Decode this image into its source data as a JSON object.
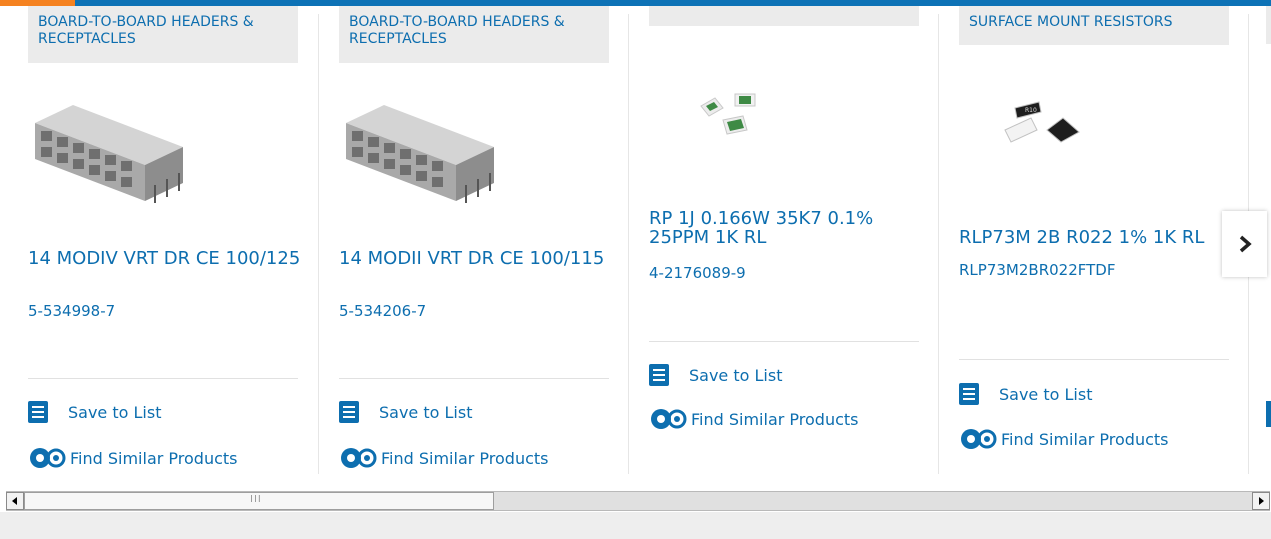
{
  "products": [
    {
      "category": "BOARD-TO-BOARD HEADERS & RECEPTACLES",
      "title": "14 MODIV VRT DR CE 100/125",
      "part_number": "5-534998-7",
      "save_label": "Save to List",
      "similar_label": "Find Similar Products",
      "image": "header-connector-image"
    },
    {
      "category": "BOARD-TO-BOARD HEADERS & RECEPTACLES",
      "title": "14 MODII VRT DR CE 100/115",
      "part_number": "5-534206-7",
      "save_label": "Save to List",
      "similar_label": "Find Similar Products",
      "image": "header-connector-image"
    },
    {
      "category": "",
      "title": "RP 1J 0.166W 35K7 0.1% 25PPM 1K RL",
      "part_number": "4-2176089-9",
      "save_label": "Save to List",
      "similar_label": "Find Similar Products",
      "image": "chip-resistor-image"
    },
    {
      "category": "SURFACE MOUNT RESISTORS",
      "title": "RLP73M 2B R022 1% 1K RL",
      "part_number": "RLP73M2BR022FTDF",
      "save_label": "Save to List",
      "similar_label": "Find Similar Products",
      "image": "chip-resistor-image"
    }
  ],
  "carousel": {
    "next_icon": "chevron-right-icon"
  },
  "colors": {
    "link": "#0d6eaf",
    "accent": "#f58220",
    "topbar": "#0d72b6"
  },
  "scrollbar": {
    "grip": "III"
  }
}
